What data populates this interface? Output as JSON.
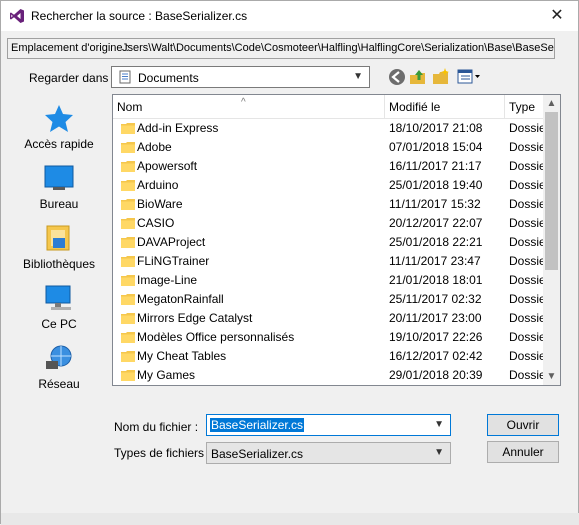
{
  "window": {
    "title": "Rechercher la source : BaseSerializer.cs",
    "close_glyph": "✕"
  },
  "origin": {
    "label": "Emplacement d'origine :",
    "value": "Jsers\\Walt\\Documents\\Code\\Cosmoteer\\Halfling\\HalflingCore\\Serialization\\Base\\BaseSeria"
  },
  "lookin": {
    "label": "Regarder dans :",
    "value": "Documents"
  },
  "toolbar": {
    "icons": [
      "back-icon",
      "up-folder-icon",
      "new-folder-icon",
      "view-menu-icon"
    ]
  },
  "places": [
    {
      "label": "Accès rapide",
      "icon": "star-icon"
    },
    {
      "label": "Bureau",
      "icon": "desktop-icon"
    },
    {
      "label": "Bibliothèques",
      "icon": "libraries-icon"
    },
    {
      "label": "Ce PC",
      "icon": "computer-icon"
    },
    {
      "label": "Réseau",
      "icon": "network-icon"
    }
  ],
  "filelist": {
    "columns": {
      "name": "Nom",
      "modified": "Modifié le",
      "type": "Type"
    },
    "rows": [
      {
        "name": "Add-in Express",
        "date": "18/10/2017 21:08",
        "type": "Dossie"
      },
      {
        "name": "Adobe",
        "date": "07/01/2018 15:04",
        "type": "Dossie"
      },
      {
        "name": "Apowersoft",
        "date": "16/11/2017 21:17",
        "type": "Dossie"
      },
      {
        "name": "Arduino",
        "date": "25/01/2018 19:40",
        "type": "Dossie"
      },
      {
        "name": "BioWare",
        "date": "11/11/2017 15:32",
        "type": "Dossie"
      },
      {
        "name": "CASIO",
        "date": "20/12/2017 22:07",
        "type": "Dossie"
      },
      {
        "name": "DAVAProject",
        "date": "25/01/2018 22:21",
        "type": "Dossie"
      },
      {
        "name": "FLiNGTrainer",
        "date": "11/11/2017 23:47",
        "type": "Dossie"
      },
      {
        "name": "Image-Line",
        "date": "21/01/2018 18:01",
        "type": "Dossie"
      },
      {
        "name": "MegatonRainfall",
        "date": "25/11/2017 02:32",
        "type": "Dossie"
      },
      {
        "name": "Mirrors Edge Catalyst",
        "date": "20/11/2017 23:00",
        "type": "Dossie"
      },
      {
        "name": "Modèles Office personnalisés",
        "date": "19/10/2017 22:26",
        "type": "Dossie"
      },
      {
        "name": "My Cheat Tables",
        "date": "16/12/2017 02:42",
        "type": "Dossie"
      },
      {
        "name": "My Games",
        "date": "29/01/2018 20:39",
        "type": "Dossie"
      }
    ]
  },
  "filename": {
    "label": "Nom du fichier :",
    "value": "BaseSerializer.cs"
  },
  "filetype": {
    "label": "Types de fichiers :",
    "value": "BaseSerializer.cs"
  },
  "buttons": {
    "open": "Ouvrir",
    "cancel": "Annuler"
  },
  "colors": {
    "accent": "#0078d7",
    "folder": "#f5c74d"
  }
}
